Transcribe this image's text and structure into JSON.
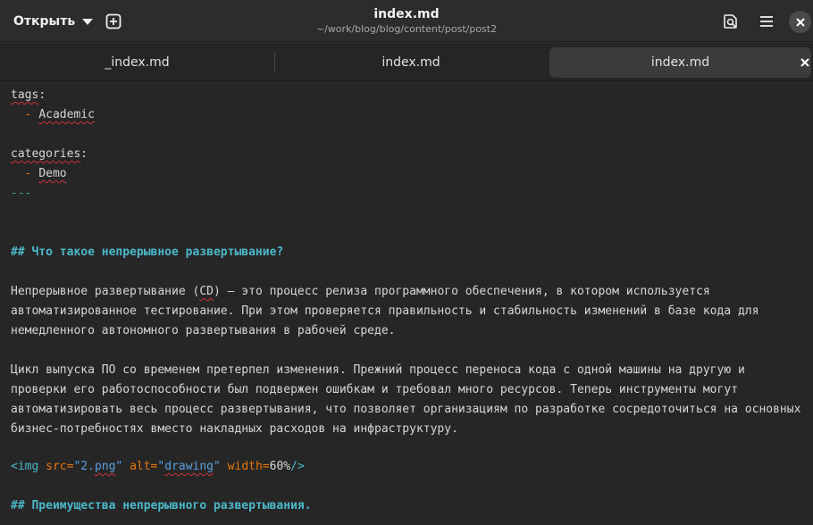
{
  "header": {
    "open_label": "Открыть",
    "title": "index.md",
    "subtitle": "~/work/blog/blog/content/post/post2"
  },
  "tabs": [
    {
      "label": "_index.md",
      "active": false
    },
    {
      "label": "index.md",
      "active": false
    },
    {
      "label": "index.md",
      "active": true
    }
  ],
  "icons": {
    "open_caret": "chevron-down-icon",
    "new_tab": "new-tab-icon",
    "search": "search-icon",
    "menu": "menu-icon",
    "close": "close-icon"
  },
  "colors": {
    "heading": "#4bb8c9",
    "list_dash": "#e8780b",
    "string": "#5c9fe0",
    "spell_error": "#d03232"
  },
  "editor": {
    "tags_key": "tags",
    "tags_colon": ":",
    "tag_dash": "-",
    "tag_value": "Academic",
    "categories_key": "categories",
    "categories_colon": ":",
    "cat_dash": "-",
    "cat_value": "Demo",
    "front_end": "---",
    "heading1": "## Что такое непрерывное развертывание?",
    "p1_l1_a": "Непрерывное развертывание (",
    "p1_l1_cd": "CD",
    "p1_l1_b": ") — это процесс релиза программного обеспечения, в котором используется",
    "p1_l2": "автоматизированное тестирование. При этом проверяется правильность и стабильность изменений в базе кода для",
    "p1_l3": "немедленного автономного развертывания в рабочей среде.",
    "p2_l1": "Цикл выпуска ПО со временем претерпел изменения. Прежний процесс переноса кода с одной машины на другую и",
    "p2_l2": "проверки его работоспособности был подвержен ошибкам и требовал много ресурсов. Теперь инструменты могут",
    "p2_l3": "автоматизировать весь процесс развертывания, что позволяет организациям по разработке сосредоточиться на основных",
    "p2_l4": "бизнес-потребностях вместо накладных расходов на инфраструктуру.",
    "img_open": "<img",
    "img_src_attr": " src=",
    "img_src_q1": "\"2.",
    "img_src_ext": "png",
    "img_src_q2": "\"",
    "img_alt_attr": " alt=",
    "img_alt_q1": "\"",
    "img_alt_val": "drawing",
    "img_alt_q2": "\"",
    "img_width_attr": " width=",
    "img_width_val": "60%",
    "img_close": "/>",
    "heading2": "## Преимущества непрерывного развертывания."
  }
}
